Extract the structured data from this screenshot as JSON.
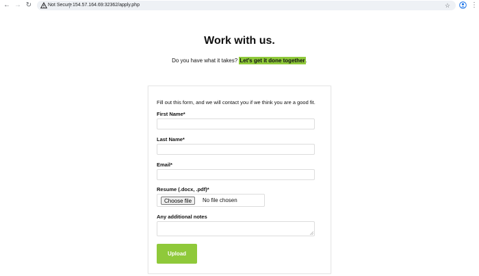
{
  "browser": {
    "security_label": "Not Secure",
    "url": "154.57.164.69:32362/apply.php",
    "icons": {
      "back": "arrow-left-icon",
      "forward": "arrow-right-icon",
      "reload": "reload-icon",
      "warning": "warning-triangle-icon",
      "bookmark": "star-icon",
      "profile": "profile-icon",
      "menu": "kebab-menu-icon"
    }
  },
  "page": {
    "title": "Work with us.",
    "tagline_prefix": "Do you have what it takes? ",
    "tagline_highlight": "Let's get it done together",
    "tagline_suffix": ".",
    "highlight_color": "#8fc93a"
  },
  "form": {
    "intro": "Fill out this form, and we will contact you if we think you are a good fit.",
    "first_name": {
      "label": "First Name*",
      "value": ""
    },
    "last_name": {
      "label": "Last Name*",
      "value": ""
    },
    "email": {
      "label": "Email*",
      "value": ""
    },
    "resume": {
      "label": "Resume (.docx, .pdf)*",
      "button_label": "Choose file",
      "status": "No file chosen"
    },
    "notes": {
      "label": "Any additional notes",
      "value": ""
    },
    "submit_label": "Upload",
    "accent_color": "#8fc93a"
  }
}
